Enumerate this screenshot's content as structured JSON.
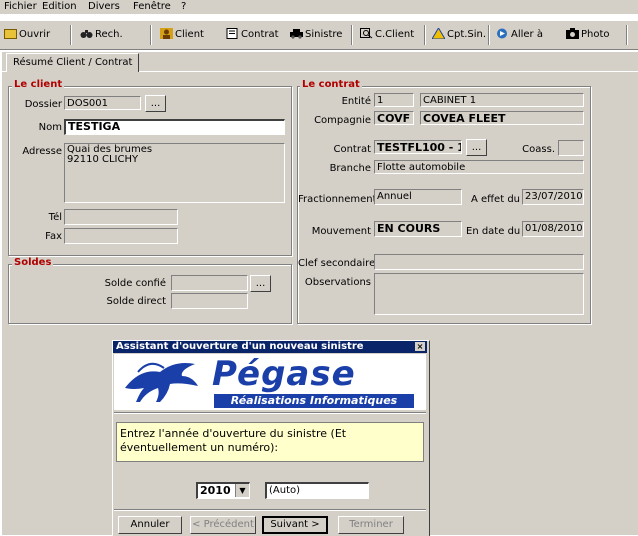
{
  "menu": [
    "Fichier",
    "Edition",
    "Divers",
    "Fenêtre",
    "?"
  ],
  "toolbar": {
    "open": "Ouvrir",
    "search": "Rech.",
    "client": "Client",
    "contract": "Contrat",
    "claim": "Sinistre",
    "c_client": "C.Client",
    "cpt_sin": "Cpt.Sin.",
    "goto": "Aller à",
    "photo": "Photo"
  },
  "tab": "Résumé Client / Contrat",
  "client": {
    "title": "Le client",
    "dossier_label": "Dossier",
    "dossier": "DOS001",
    "browse": "...",
    "name_label": "Nom",
    "name": "TESTIGA",
    "address_label": "Adresse",
    "address": "Quai des brumes\n92110 CLICHY",
    "tel_label": "Tél",
    "tel": "",
    "fax_label": "Fax",
    "fax": ""
  },
  "soldes": {
    "title": "Soldes",
    "solde_confie_label": "Solde confié",
    "solde_confie": "",
    "solde_direct_label": "Solde direct",
    "solde_direct": "",
    "browse": "..."
  },
  "contract": {
    "title": "Le contrat",
    "entity_label": "Entité",
    "entity_code": "1",
    "entity_name": "CABINET 1",
    "company_label": "Compagnie",
    "company_code": "COVF",
    "company_name": "COVEA FLEET",
    "contract_label": "Contrat",
    "contract": "TESTFL100 - 1",
    "browse": "...",
    "coass_label": "Coass.",
    "coass": "",
    "branch_label": "Branche",
    "branch": "Flotte automobile",
    "split_label": "Fractionnement",
    "split": "Annuel",
    "effect_label": "A effet du",
    "effect": "23/07/2010",
    "movement_label": "Mouvement",
    "movement": "EN COURS",
    "date_label": "En date du",
    "date": "01/08/2010",
    "secondary_key_label": "Clef secondaire",
    "secondary_key": "",
    "observations_label": "Observations",
    "observations": ""
  },
  "dialog": {
    "title": "Assistant d'ouverture d'un nouveau sinistre",
    "close": "×",
    "logo_word": "Pégase",
    "logo_sub": "Réalisations Informatiques",
    "prompt": "Entrez l'année d'ouverture du sinistre (Et éventuellement un numéro):",
    "year": "2010",
    "number": "(Auto)",
    "btn_cancel": "Annuler",
    "btn_prev": "< Précédent",
    "btn_next": "Suivant >",
    "btn_finish": "Terminer"
  },
  "colors": {
    "title_red": "#b00000",
    "dialog_title_bg": "#0a246a",
    "prompt_bg": "#ffffcc",
    "logo_blue": "#1a3fa8"
  }
}
